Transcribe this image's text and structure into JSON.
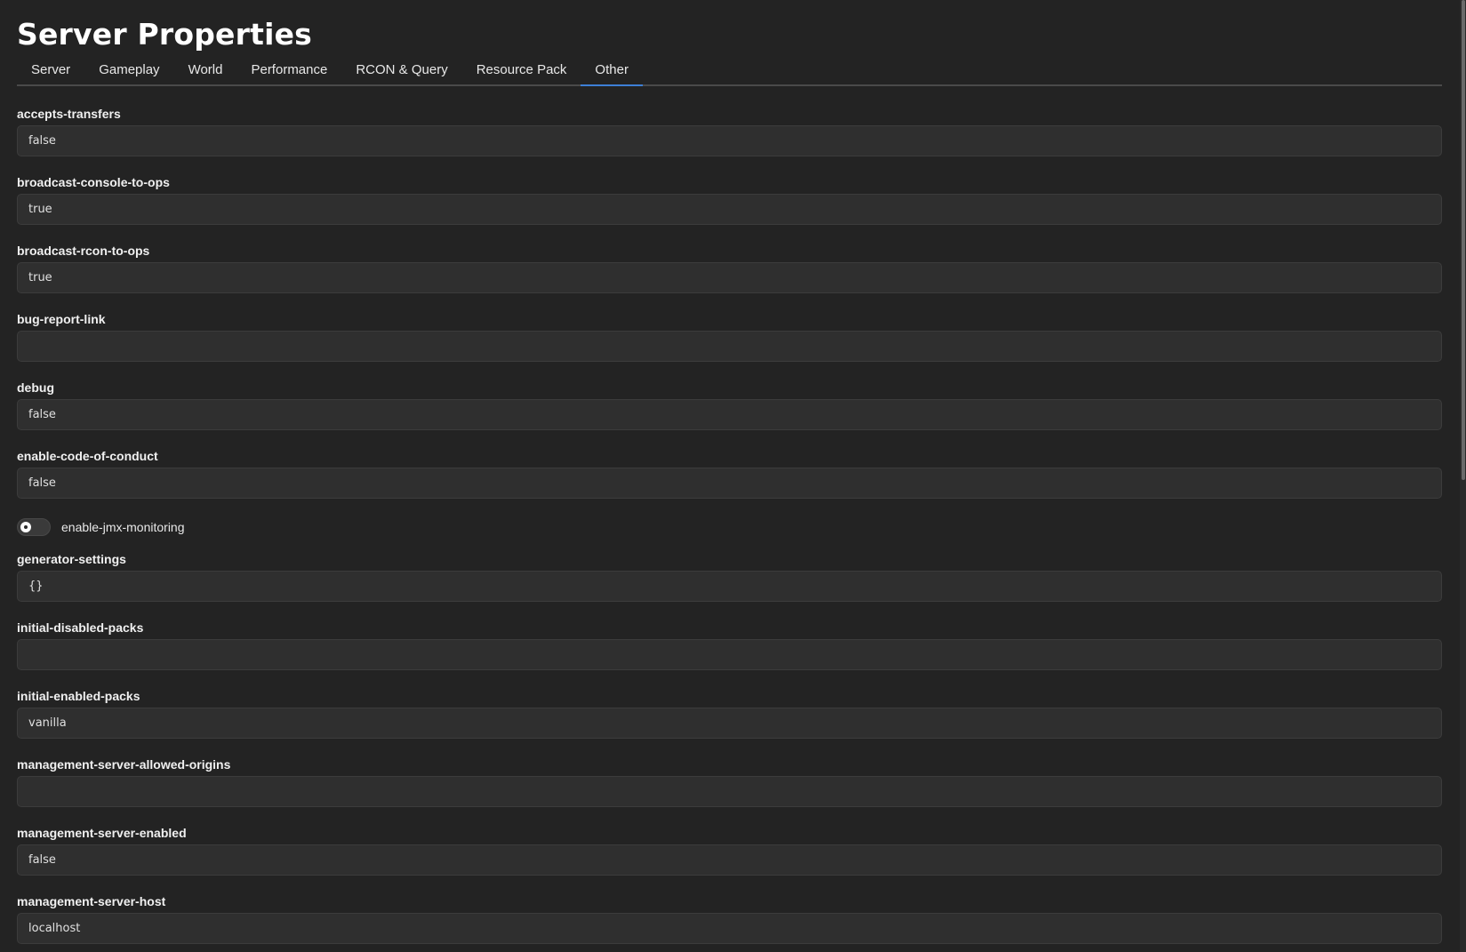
{
  "page": {
    "title": "Server Properties"
  },
  "tabs": [
    {
      "label": "Server",
      "active": false
    },
    {
      "label": "Gameplay",
      "active": false
    },
    {
      "label": "World",
      "active": false
    },
    {
      "label": "Performance",
      "active": false
    },
    {
      "label": "RCON & Query",
      "active": false
    },
    {
      "label": "Resource Pack",
      "active": false
    },
    {
      "label": "Other",
      "active": true
    }
  ],
  "fields": {
    "accepts_transfers": {
      "label": "accepts-transfers",
      "value": "false"
    },
    "broadcast_console_to_ops": {
      "label": "broadcast-console-to-ops",
      "value": "true"
    },
    "broadcast_rcon_to_ops": {
      "label": "broadcast-rcon-to-ops",
      "value": "true"
    },
    "bug_report_link": {
      "label": "bug-report-link",
      "value": ""
    },
    "debug": {
      "label": "debug",
      "value": "false"
    },
    "enable_code_of_conduct": {
      "label": "enable-code-of-conduct",
      "value": "false"
    },
    "enable_jmx_monitoring": {
      "label": "enable-jmx-monitoring",
      "enabled": false
    },
    "generator_settings": {
      "label": "generator-settings",
      "value": "{}"
    },
    "initial_disabled_packs": {
      "label": "initial-disabled-packs",
      "value": ""
    },
    "initial_enabled_packs": {
      "label": "initial-enabled-packs",
      "value": "vanilla"
    },
    "management_server_allowed_origins": {
      "label": "management-server-allowed-origins",
      "value": ""
    },
    "management_server_enabled": {
      "label": "management-server-enabled",
      "value": "false"
    },
    "management_server_host": {
      "label": "management-server-host",
      "value": "localhost"
    }
  },
  "colors": {
    "background": "#232323",
    "input_background": "#2f2f2f",
    "active_tab_underline": "#3d7fd6"
  }
}
